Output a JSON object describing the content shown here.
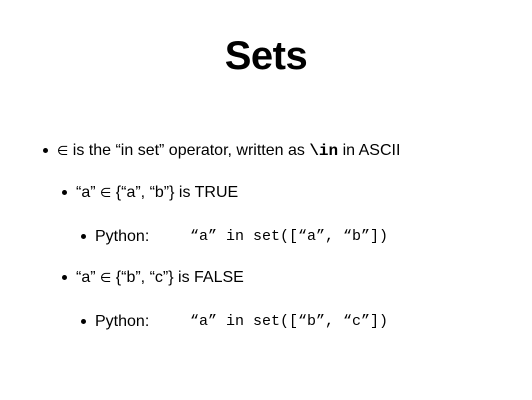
{
  "slide": {
    "title": "Sets",
    "items": [
      {
        "symbol": "∈",
        "text_before_code": " is the “in set” operator, written as ",
        "code": "\\in",
        "text_after_code": " in ASCII"
      },
      {
        "lhs": "“a” ",
        "symbol": "∈",
        "rhs": " {“a”, “b”} is TRUE",
        "python_label": "Python:",
        "python_code": "“a” in set([“a”, “b”])"
      },
      {
        "lhs": "“a” ",
        "symbol": "∈",
        "rhs": " {“b”, “c”} is FALSE",
        "python_label": "Python:",
        "python_code": "“a” in set([“b”, “c”])"
      }
    ]
  }
}
